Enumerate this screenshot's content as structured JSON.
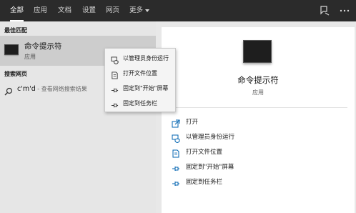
{
  "tabs": [
    {
      "label": "全部",
      "active": true
    },
    {
      "label": "应用",
      "active": false
    },
    {
      "label": "文档",
      "active": false
    },
    {
      "label": "设置",
      "active": false
    },
    {
      "label": "网页",
      "active": false
    },
    {
      "label": "更多",
      "active": false
    }
  ],
  "topbar_icons": [
    "feedback-icon",
    "more-options-icon"
  ],
  "best_match": {
    "section_title": "最佳匹配",
    "app_name": "命令提示符",
    "app_type": "应用",
    "icon": "command-prompt-icon"
  },
  "web_search": {
    "section_title": "搜索网页",
    "query": "c'm'd",
    "suffix": " - 查看网络搜索结果",
    "icon": "search-icon"
  },
  "context_menu": {
    "items": [
      {
        "label": "以管理员身份运行",
        "icon": "run-as-admin-icon"
      },
      {
        "label": "打开文件位置",
        "icon": "file-location-icon"
      },
      {
        "label": "固定到\"开始\"屏幕",
        "icon": "pin-icon"
      },
      {
        "label": "固定到任务栏",
        "icon": "pin-icon"
      }
    ]
  },
  "detail": {
    "app_name": "命令提示符",
    "app_type": "应用",
    "actions": [
      {
        "label": "打开",
        "icon": "open-icon"
      },
      {
        "label": "以管理员身份运行",
        "icon": "run-as-admin-icon"
      },
      {
        "label": "打开文件位置",
        "icon": "file-location-icon"
      },
      {
        "label": "固定到\"开始\"屏幕",
        "icon": "pin-icon"
      },
      {
        "label": "固定到任务栏",
        "icon": "pin-icon"
      }
    ]
  },
  "colors": {
    "topbar": "#2b2b2b",
    "accent": "#0063b1",
    "selected_row": "#cdcdcd",
    "left_pane": "#e6e6e6"
  }
}
